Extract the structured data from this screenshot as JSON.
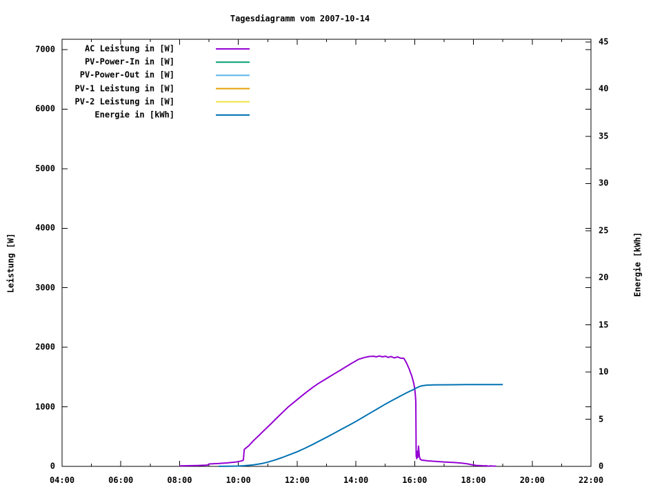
{
  "title": "Tagesdiagramm vom 2007-10-14",
  "chart_data": {
    "type": "line",
    "title": "Tagesdiagramm vom 2007-10-14",
    "xlabel": "",
    "ylabel_left": "Leistung [W]",
    "ylabel_right": "Energie [kWh]",
    "x_range_hours": [
      4,
      22
    ],
    "x_major_ticks": [
      "04:00",
      "06:00",
      "08:00",
      "10:00",
      "12:00",
      "14:00",
      "16:00",
      "18:00",
      "20:00",
      "22:00"
    ],
    "x_major_tick_hours": [
      4,
      6,
      8,
      10,
      12,
      14,
      16,
      18,
      20,
      22
    ],
    "x_minor_tick_interval_hours": 1,
    "y_left_ticks": [
      0,
      1000,
      2000,
      3000,
      4000,
      5000,
      6000,
      7000
    ],
    "y_left_range": [
      0,
      7175
    ],
    "y_right_ticks": [
      0,
      5,
      10,
      15,
      20,
      25,
      30,
      35,
      40,
      45
    ],
    "y_right_range": [
      0,
      45.3
    ],
    "grid": false,
    "legend_position": "top-left-inside",
    "background": "#ffffff",
    "axis_color": "#000000",
    "series": [
      {
        "name": "AC Leistung in [W]",
        "color": "#9400d3",
        "axis": "left",
        "unit": "W",
        "points": [
          [
            8.0,
            8
          ],
          [
            8.3,
            12
          ],
          [
            8.6,
            15
          ],
          [
            8.95,
            22
          ],
          [
            9.0,
            40
          ],
          [
            9.3,
            48
          ],
          [
            9.6,
            58
          ],
          [
            9.9,
            72
          ],
          [
            10.1,
            90
          ],
          [
            10.17,
            105
          ],
          [
            10.2,
            285
          ],
          [
            10.35,
            345
          ],
          [
            10.5,
            425
          ],
          [
            10.7,
            520
          ],
          [
            10.9,
            615
          ],
          [
            11.1,
            710
          ],
          [
            11.3,
            810
          ],
          [
            11.5,
            905
          ],
          [
            11.7,
            1000
          ],
          [
            11.9,
            1080
          ],
          [
            12.1,
            1160
          ],
          [
            12.3,
            1240
          ],
          [
            12.5,
            1315
          ],
          [
            12.7,
            1385
          ],
          [
            12.9,
            1445
          ],
          [
            13.1,
            1505
          ],
          [
            13.3,
            1565
          ],
          [
            13.5,
            1625
          ],
          [
            13.7,
            1685
          ],
          [
            13.9,
            1745
          ],
          [
            14.1,
            1800
          ],
          [
            14.3,
            1830
          ],
          [
            14.45,
            1845
          ],
          [
            14.6,
            1850
          ],
          [
            14.7,
            1840
          ],
          [
            14.8,
            1855
          ],
          [
            14.9,
            1840
          ],
          [
            15.0,
            1850
          ],
          [
            15.1,
            1830
          ],
          [
            15.2,
            1845
          ],
          [
            15.3,
            1822
          ],
          [
            15.42,
            1838
          ],
          [
            15.52,
            1818
          ],
          [
            15.63,
            1815
          ],
          [
            15.68,
            1775
          ],
          [
            15.73,
            1730
          ],
          [
            15.78,
            1672
          ],
          [
            15.82,
            1628
          ],
          [
            15.86,
            1570
          ],
          [
            15.9,
            1520
          ],
          [
            15.94,
            1450
          ],
          [
            15.97,
            1390
          ],
          [
            16.0,
            1315
          ],
          [
            16.02,
            1215
          ],
          [
            16.04,
            1085
          ],
          [
            16.05,
            180
          ],
          [
            16.07,
            130
          ],
          [
            16.09,
            255
          ],
          [
            16.11,
            150
          ],
          [
            16.13,
            340
          ],
          [
            16.16,
            165
          ],
          [
            16.19,
            120
          ],
          [
            16.24,
            105
          ],
          [
            16.45,
            92
          ],
          [
            16.75,
            82
          ],
          [
            17.05,
            73
          ],
          [
            17.35,
            65
          ],
          [
            17.6,
            56
          ],
          [
            17.8,
            42
          ],
          [
            17.95,
            28
          ],
          [
            18.1,
            16
          ],
          [
            18.3,
            12
          ],
          [
            18.45,
            10
          ],
          [
            18.5,
            2
          ],
          [
            18.56,
            8
          ],
          [
            18.65,
            6
          ],
          [
            18.77,
            5
          ]
        ]
      },
      {
        "name": "PV-Power-In in [W]",
        "color": "#009e73",
        "axis": "left",
        "unit": "W",
        "points": []
      },
      {
        "name": "PV-Power-Out in [W]",
        "color": "#56b4e9",
        "axis": "left",
        "unit": "W",
        "points": []
      },
      {
        "name": "PV-1 Leistung in [W]",
        "color": "#e69f00",
        "axis": "left",
        "unit": "W",
        "points": []
      },
      {
        "name": "PV-2 Leistung in [W]",
        "color": "#f0e442",
        "axis": "left",
        "unit": "W",
        "points": []
      },
      {
        "name": "Energie in [kWh]",
        "color": "#0072b2",
        "axis": "right",
        "unit": "kWh",
        "points": [
          [
            9.33,
            0.01
          ],
          [
            9.7,
            0.02
          ],
          [
            10.0,
            0.04
          ],
          [
            10.2,
            0.07
          ],
          [
            10.5,
            0.15
          ],
          [
            10.8,
            0.3
          ],
          [
            11.0,
            0.45
          ],
          [
            11.25,
            0.68
          ],
          [
            11.5,
            0.95
          ],
          [
            11.75,
            1.25
          ],
          [
            12.0,
            1.55
          ],
          [
            12.25,
            1.9
          ],
          [
            12.5,
            2.28
          ],
          [
            12.75,
            2.68
          ],
          [
            13.0,
            3.08
          ],
          [
            13.25,
            3.5
          ],
          [
            13.5,
            3.92
          ],
          [
            13.75,
            4.34
          ],
          [
            14.0,
            4.76
          ],
          [
            14.25,
            5.22
          ],
          [
            14.5,
            5.68
          ],
          [
            14.75,
            6.14
          ],
          [
            15.0,
            6.6
          ],
          [
            15.25,
            7.02
          ],
          [
            15.5,
            7.44
          ],
          [
            15.65,
            7.68
          ],
          [
            15.8,
            7.92
          ],
          [
            15.95,
            8.14
          ],
          [
            16.05,
            8.3
          ],
          [
            16.15,
            8.45
          ],
          [
            16.25,
            8.55
          ],
          [
            16.4,
            8.61
          ],
          [
            16.6,
            8.64
          ],
          [
            16.9,
            8.65
          ],
          [
            17.3,
            8.66
          ],
          [
            17.8,
            8.67
          ],
          [
            18.3,
            8.68
          ],
          [
            19.0,
            8.68
          ]
        ]
      }
    ]
  }
}
